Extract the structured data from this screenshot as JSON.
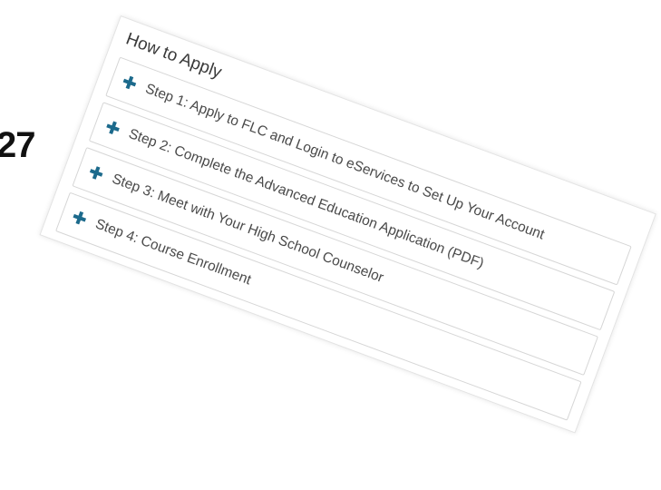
{
  "page": {
    "corner_number": "27"
  },
  "panel": {
    "title": "How to Apply",
    "steps": [
      {
        "label": "Step 1: Apply to FLC and Login to eServices to Set Up Your Account"
      },
      {
        "label": "Step 2: Complete the Advanced Education Application (PDF)"
      },
      {
        "label": "Step 3: Meet with Your High School Counselor"
      },
      {
        "label": "Step 4: Course Enrollment"
      }
    ]
  },
  "colors": {
    "accent": "#1c6a8c",
    "text": "#4a4a4a",
    "border": "#d6d6d6"
  },
  "icons": {
    "expand": "plus-icon"
  }
}
